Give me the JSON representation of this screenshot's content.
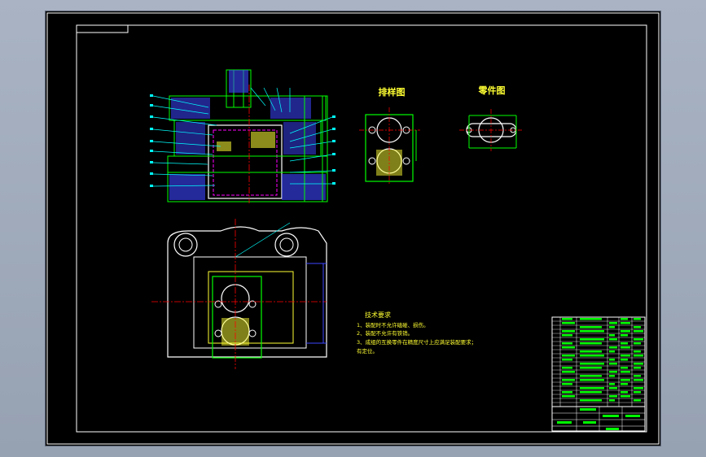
{
  "drawing": {
    "views": {
      "blank_layout_title": "排样图",
      "part_title": "零件图"
    },
    "technical_requirements": {
      "title": "技术要求",
      "lines": [
        "1、装配时不允许磕碰、损伤。",
        "2、装配不允许有铁销。",
        "3、成组的互换零件在精度尺寸上应满足装配要求；",
        "   有定位。"
      ]
    }
  },
  "colors": {
    "background": "#000000",
    "frame": "#ffffff",
    "outline": "#00ff00",
    "text": "#ffff33",
    "centerline": "#ff0000",
    "hatch_blue": "#3c46ff",
    "leaders": "#00ffff",
    "hidden": "#ff00ff",
    "viewport_bg": "#a9b3c3"
  }
}
